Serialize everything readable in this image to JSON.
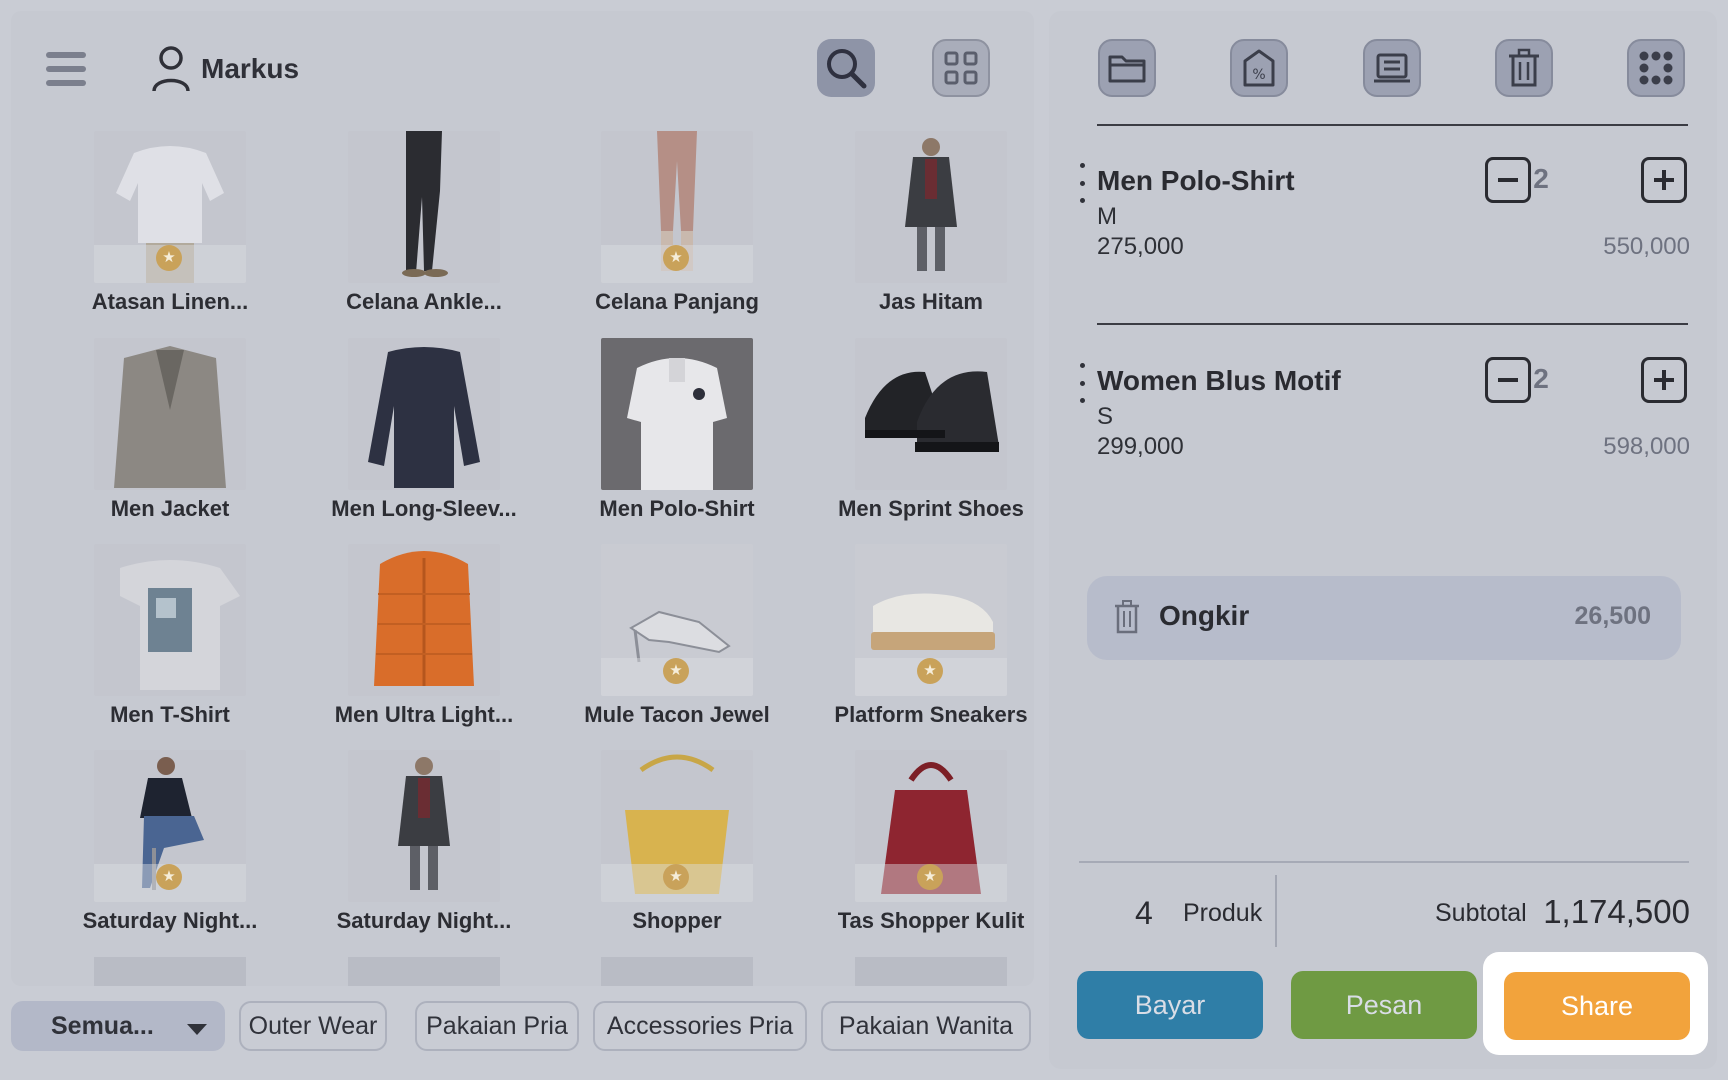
{
  "header": {
    "user_name": "Markus"
  },
  "products": [
    {
      "name": "Atasan Linen...",
      "star": true,
      "img": "blouse"
    },
    {
      "name": "Celana Ankle...",
      "star": false,
      "img": "pants-black"
    },
    {
      "name": "Celana Panjang",
      "star": true,
      "img": "pants-pink"
    },
    {
      "name": "Jas Hitam",
      "star": false,
      "img": "man-coat"
    },
    {
      "name": "Men Jacket",
      "star": false,
      "img": "blazer"
    },
    {
      "name": "Men Long-Sleev...",
      "star": false,
      "img": "sweater"
    },
    {
      "name": "Men Polo-Shirt",
      "star": false,
      "img": "polo"
    },
    {
      "name": "Men Sprint Shoes",
      "star": false,
      "img": "shoes"
    },
    {
      "name": "Men T-Shirt",
      "star": false,
      "img": "tshirt"
    },
    {
      "name": "Men Ultra Light...",
      "star": false,
      "img": "puffer"
    },
    {
      "name": "Mule Tacon Jewel",
      "star": true,
      "img": "sandal"
    },
    {
      "name": "Platform Sneakers",
      "star": true,
      "img": "sneaker"
    },
    {
      "name": "Saturday Night...",
      "star": true,
      "img": "woman-sitting"
    },
    {
      "name": "Saturday Night...",
      "star": false,
      "img": "man-coat"
    },
    {
      "name": "Shopper",
      "star": true,
      "img": "bag-yellow"
    },
    {
      "name": "Tas Shopper Kulit",
      "star": true,
      "img": "bag-red"
    }
  ],
  "categories": {
    "active": "Semua...",
    "items": [
      "Outer Wear",
      "Pakaian Pria",
      "Accessories Pria",
      "Pakaian Wanita"
    ]
  },
  "cart": {
    "items": [
      {
        "name": "Men Polo-Shirt",
        "variant": "M",
        "price": "275,000",
        "qty": "2",
        "total": "550,000"
      },
      {
        "name": "Women Blus Motif",
        "variant": "S",
        "price": "299,000",
        "qty": "2",
        "total": "598,000"
      }
    ],
    "shipping": {
      "label": "Ongkir",
      "amount": "26,500"
    }
  },
  "summary": {
    "count": "4",
    "count_label": "Produk",
    "subtotal_label": "Subtotal",
    "subtotal": "1,174,500"
  },
  "actions": {
    "pay": "Bayar",
    "order": "Pesan",
    "share": "Share"
  },
  "colors": {
    "pay": "#2f7ea7",
    "order": "#6f9a43",
    "share": "#f2a33c",
    "overlay": "#c6c9d1"
  }
}
